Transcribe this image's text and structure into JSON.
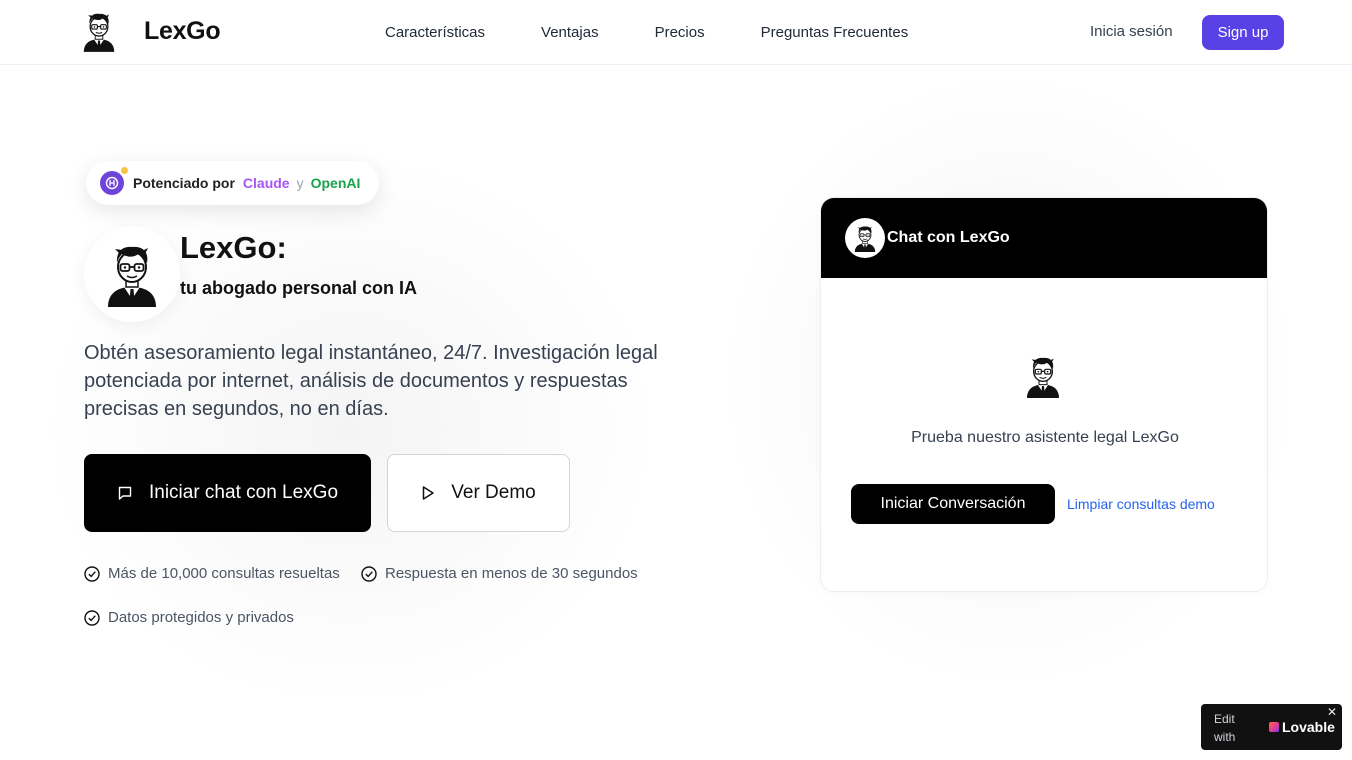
{
  "header": {
    "brand": "LexGo",
    "nav": [
      {
        "label": "Características"
      },
      {
        "label": "Ventajas"
      },
      {
        "label": "Precios"
      },
      {
        "label": "Preguntas Frecuentes"
      }
    ],
    "login_label": "Inicia sesión",
    "signup_label": "Sign up"
  },
  "badge": {
    "prefix": "Potenciado por",
    "claude": "Claude",
    "connector": "y",
    "openai": "OpenAI"
  },
  "hero": {
    "title": "LexGo:",
    "subtitle": "tu abogado personal con IA",
    "description": "Obtén asesoramiento legal instantáneo, 24/7. Investigación legal potenciada por internet, análisis de documentos y respuestas precisas en segundos, no en días.",
    "primary_button": "Iniciar chat con LexGo",
    "secondary_button": "Ver Demo",
    "checks": [
      "Más de 10,000 consultas resueltas",
      "Respuesta en menos de 30 segundos",
      "Datos protegidos y privados"
    ]
  },
  "chat_card": {
    "title": "Chat con LexGo",
    "prompt": "Prueba nuestro asistente legal LexGo",
    "start_button": "Iniciar Conversación",
    "clear_link": "Limpiar consultas demo"
  },
  "lovable": {
    "edit_label": "Edit with",
    "brand": "Lovable",
    "close": "✕"
  },
  "colors": {
    "accent": "#5a41e6",
    "claude": "#a855f7",
    "openai": "#16a34a",
    "link": "#2563eb"
  },
  "icons": [
    "lawyer-avatar-icon",
    "ai-chip-icon",
    "chat-bubble-icon",
    "play-icon",
    "check-circle-icon",
    "lovable-heart-icon",
    "close-icon"
  ]
}
